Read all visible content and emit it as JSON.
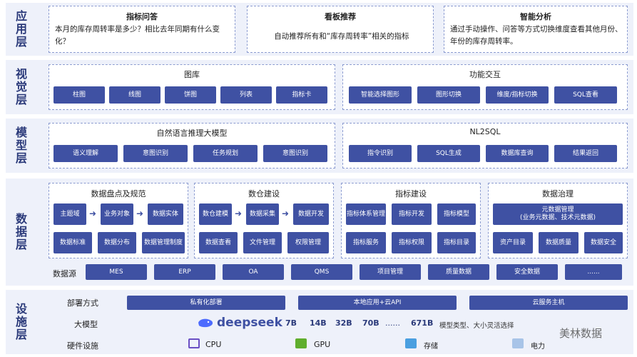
{
  "layers": {
    "app": "应用层",
    "view": "视觉层",
    "model": "模型层",
    "data": "数据层",
    "infra": "设施层"
  },
  "app": {
    "cards": [
      {
        "title": "指标问答",
        "body": "本月的库存周转率是多少？相比去年同期有什么变化？"
      },
      {
        "title": "看板推荐",
        "body": "自动推荐所有和“库存周转率”相关的指标"
      },
      {
        "title": "智能分析",
        "body": "通过手动操作、问答等方式切换维度查看其他月份、年份的库存周转率。"
      }
    ]
  },
  "view": {
    "gallery": {
      "title": "图库",
      "items": [
        "柱图",
        "线图",
        "饼图",
        "列表",
        "指标卡"
      ]
    },
    "interaction": {
      "title": "功能交互",
      "items": [
        "智能选择图形",
        "图形切换",
        "维度/指标切换",
        "SQL查看"
      ]
    }
  },
  "model": {
    "nlp": {
      "title": "自然语言推理大模型",
      "items": [
        "语义理解",
        "意图识别",
        "任务规划",
        "意图识别"
      ]
    },
    "nl2sql": {
      "title": "NL2SQL",
      "items": [
        "指令识别",
        "SQL生成",
        "数据库查询",
        "结果返回"
      ]
    }
  },
  "data": {
    "inventory": {
      "title": "数据盘点及规范",
      "flow": [
        "主题域",
        "业务对象",
        "数据实体"
      ],
      "items": [
        "数据标准",
        "数据分布",
        "数据管理制度"
      ]
    },
    "warehouse": {
      "title": "数仓建设",
      "flow": [
        "数仓建模",
        "数据采集",
        "数据开发"
      ],
      "items": [
        "数据查看",
        "文件管理",
        "权限管理"
      ]
    },
    "metrics": {
      "title": "指标建设",
      "top": [
        "指标体系管理",
        "指标开发",
        "指标模型"
      ],
      "items": [
        "指标服务",
        "指标权限",
        "指标目录"
      ]
    },
    "governance": {
      "title": "数据治理",
      "meta": "元数据管理\n(业务元数据、技术元数据)",
      "items": [
        "资产目录",
        "数据质量",
        "数据安全"
      ]
    },
    "sources_label": "数据源",
    "sources": [
      "MES",
      "ERP",
      "OA",
      "QMS",
      "项目管理",
      "质量数据",
      "安全数据",
      "......"
    ]
  },
  "infra": {
    "deploy_label": "部署方式",
    "deploy": [
      "私有化部署",
      "本地应用+云API",
      "云服务主机"
    ],
    "llm_label": "大模型",
    "llm_brand": "deepseek",
    "llm_sizes": [
      "7B",
      "14B",
      "32B",
      "70B",
      "......",
      "671B"
    ],
    "llm_note": "模型类型、大小灵活选择",
    "hw_label": "硬件设施",
    "hw": [
      "CPU",
      "GPU",
      "存储",
      "电力"
    ],
    "watermark": "美林数据"
  },
  "colors": {
    "accent": "#3f51a3",
    "layer_bg": "#eef1fa",
    "dash": "#8b9bd0"
  }
}
